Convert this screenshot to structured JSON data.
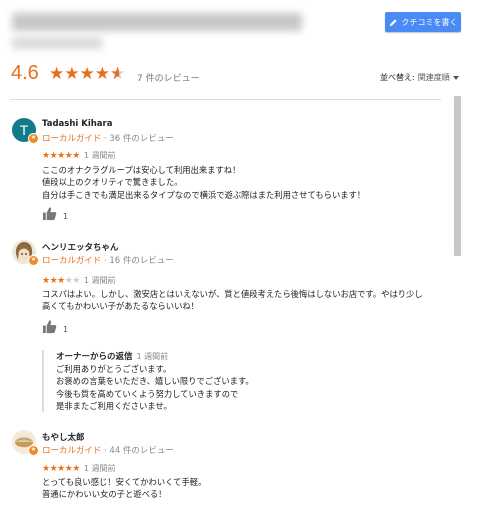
{
  "header": {
    "write_review_label": "クチコミを書く",
    "rating": "4.6",
    "stars_fraction": 0.92,
    "review_count": "7 件のレビュー",
    "sort_label": "並べ替え:",
    "sort_value": "関連度順"
  },
  "reviews": [
    {
      "avatar_letter": "T",
      "name": "Tadashi Kihara",
      "local_guide": "ローカルガイド",
      "review_count": "· 36 件のレビュー",
      "stars": 5,
      "date": "1 週間前",
      "lines": [
        "ここのオナクラグループは安心して利用出来ますね！",
        "値段以上のクオリティで驚きました。",
        "自分は手こきでも満足出来るタイプなので横浜で遊ぶ際はまた利用させてもらいます！"
      ],
      "likes": "1"
    },
    {
      "name": "ヘンリエッタちゃん",
      "local_guide": "ローカルガイド",
      "review_count": "· 16 件のレビュー",
      "stars": 3,
      "date": "1 週間前",
      "lines": [
        "コスパはよい。しかし、激安店とはいえないが、質と値段考えたら後悔はしないお店です。やはり少し",
        "高くてもかわいい子があたるならいいね！"
      ],
      "likes": "1",
      "owner_reply": {
        "title": "オーナーからの返信",
        "date": "1 週間前",
        "lines": [
          "ご利用ありがとうございます。",
          "お褒めの言葉をいただき、嬉しい限りでございます。",
          "今後も質を高めていくよう努力していきますので",
          "是非またご利用くださいませ。"
        ]
      }
    },
    {
      "name": "もやし太郎",
      "local_guide": "ローカルガイド",
      "review_count": "· 44 件のレビュー",
      "stars": 5,
      "date": "1 週間前",
      "lines": [
        "とっても良い感じ！安くてかわいくて手軽。",
        "普通にかわいい女の子と遊べる！"
      ]
    }
  ],
  "colors": {
    "accent_orange": "#e7711b",
    "button_blue": "#4a8af4",
    "avatar_teal": "#117a8b"
  }
}
